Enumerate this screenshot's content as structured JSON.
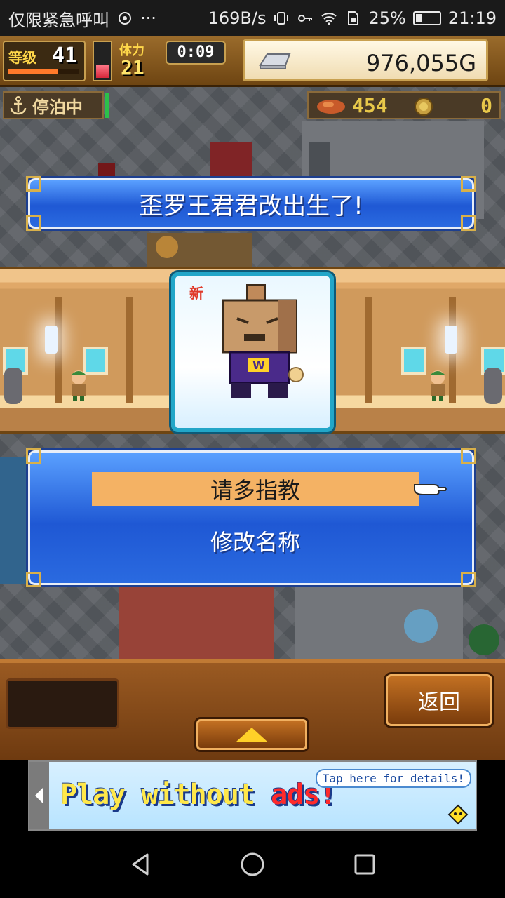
{
  "status_bar": {
    "carrier": "仅限紧急呼叫",
    "net_speed": "169B/s",
    "battery": "25%",
    "battery_level": 0.25,
    "time": "21:19"
  },
  "hud": {
    "level_label": "等级",
    "level_value": "41",
    "level_progress": 0.7,
    "stamina_label": "体力",
    "stamina_value": "21",
    "stamina_fill": 0.35,
    "timer": "0:09",
    "money": "976,055G",
    "dock_status": "停泊中",
    "food_value": "454",
    "coin_value": "0"
  },
  "message": {
    "text": "歪罗王君君改出生了!"
  },
  "card": {
    "new_tag": "新"
  },
  "menu": {
    "option_1": "请多指教",
    "option_2": "修改名称"
  },
  "bottom": {
    "back_label": "返回"
  },
  "ad": {
    "headline_part1": "Play without ",
    "headline_part2": "ads!",
    "bubble": "Tap here for details!"
  },
  "colors": {
    "panel_blue": "#2a6ae0",
    "highlight": "#f4b264",
    "wood": "#9a5a22",
    "card_border": "#22a6c8"
  }
}
